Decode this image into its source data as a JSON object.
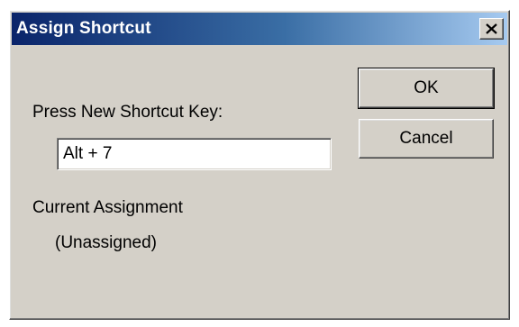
{
  "dialog": {
    "title": "Assign Shortcut",
    "close_icon": "close-icon",
    "prompt_label": "Press New Shortcut Key:",
    "shortcut_value": "Alt + 7",
    "current_assignment_label": "Current Assignment",
    "current_assignment_value": "(Unassigned)",
    "ok_label": "OK",
    "cancel_label": "Cancel"
  }
}
